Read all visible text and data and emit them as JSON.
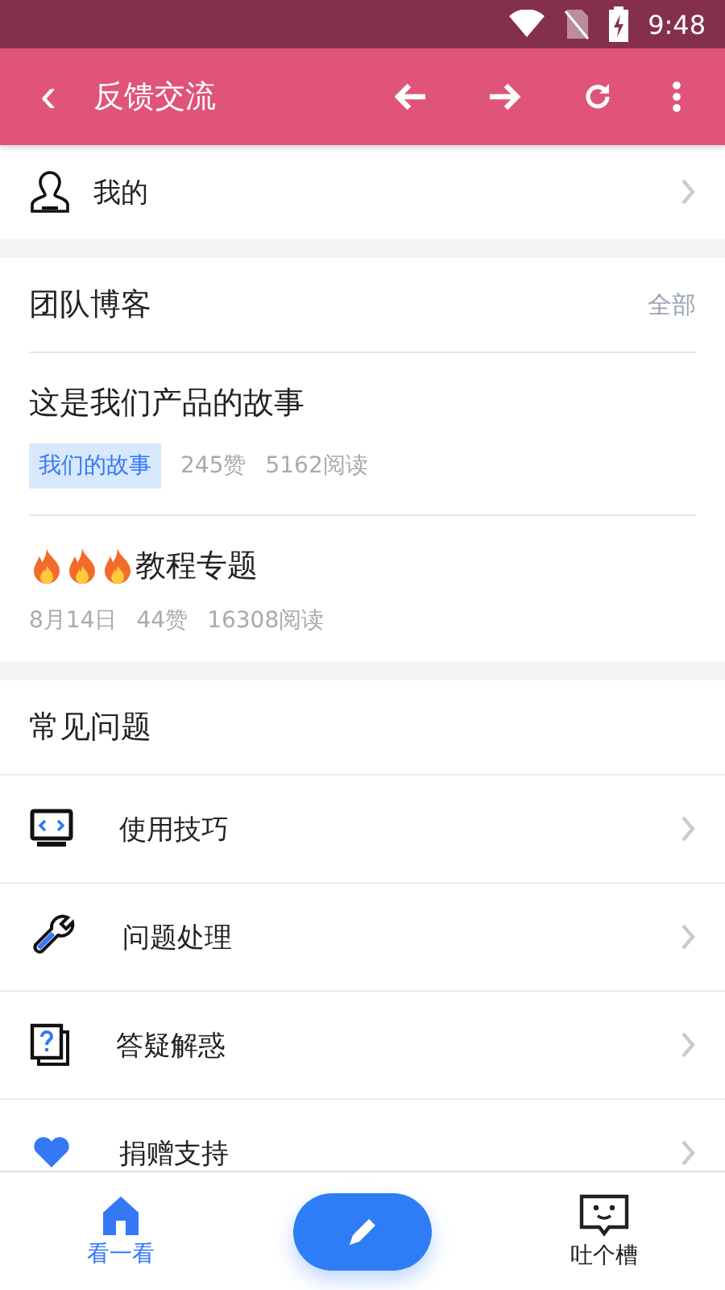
{
  "status_bar": {
    "time": "9:48"
  },
  "toolbar": {
    "back": "‹",
    "title": "反馈交流"
  },
  "me": {
    "label": "我的"
  },
  "blog": {
    "title": "团队博客",
    "more": "全部",
    "posts": [
      {
        "kind": "tagged",
        "title": "这是我们产品的故事",
        "tag": "我们的故事",
        "likes": "245赞",
        "reads": "5162阅读"
      },
      {
        "kind": "hot",
        "icons": [
          {
            "kind": "flame"
          },
          {
            "kind": "flame"
          },
          {
            "kind": "flame"
          }
        ],
        "title": "教程专题",
        "date": "8月14日",
        "likes": "44赞",
        "reads": "16308阅读"
      }
    ]
  },
  "faq": {
    "title": "常见问题",
    "items": [
      {
        "kind": "monitor",
        "label": "使用技巧"
      },
      {
        "kind": "wrench",
        "label": "问题处理"
      },
      {
        "kind": "question",
        "label": "答疑解惑"
      },
      {
        "kind": "heart",
        "label": "捐赠支持"
      }
    ]
  },
  "bottom_nav": [
    {
      "kind": "home",
      "label": "看一看",
      "selected": true
    },
    {
      "kind": "compose"
    },
    {
      "kind": "chat",
      "label": "吐个槽",
      "selected": false
    }
  ]
}
